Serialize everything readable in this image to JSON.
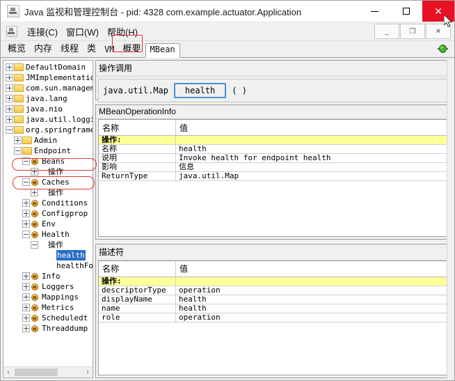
{
  "window": {
    "title": "Java 监视和管理控制台 - pid: 4328 com.example.actuator.Application",
    "app_icon": "java-console-icon",
    "minimize_label": "",
    "maximize_label": "",
    "close_label": "✕"
  },
  "menubar": {
    "icon": "java-console-icon",
    "items": [
      {
        "label": "连接(C)"
      },
      {
        "label": "窗口(W)"
      },
      {
        "label": "帮助(H)"
      }
    ],
    "internal_buttons": [
      {
        "name": "internal-minimize",
        "label": "_"
      },
      {
        "name": "internal-restore",
        "label": "❐"
      },
      {
        "name": "internal-close",
        "label": "✕"
      }
    ]
  },
  "tabs": {
    "items": [
      {
        "label": "概览",
        "selected": false
      },
      {
        "label": "内存",
        "selected": false
      },
      {
        "label": "线程",
        "selected": false
      },
      {
        "label": "类",
        "selected": false
      },
      {
        "label": "VM",
        "selected": false
      },
      {
        "label": "概要",
        "selected": false
      },
      {
        "label": "MBean",
        "selected": true
      }
    ],
    "status_icon": "green-plug-connected-icon"
  },
  "tree": {
    "nodes": [
      {
        "label": "DefaultDomain",
        "indent": 0,
        "handle": "plus",
        "icon": "folder"
      },
      {
        "label": "JMImplementatio",
        "indent": 0,
        "handle": "plus",
        "icon": "folder"
      },
      {
        "label": "com.sun.managem",
        "indent": 0,
        "handle": "plus",
        "icon": "folder"
      },
      {
        "label": "java.lang",
        "indent": 0,
        "handle": "plus",
        "icon": "folder"
      },
      {
        "label": "java.nio",
        "indent": 0,
        "handle": "plus",
        "icon": "folder"
      },
      {
        "label": "java.util.loggi",
        "indent": 0,
        "handle": "plus",
        "icon": "folder"
      },
      {
        "label": "org.springframe",
        "indent": 0,
        "handle": "minus",
        "icon": "folder"
      },
      {
        "label": "Admin",
        "indent": 1,
        "handle": "plus",
        "icon": "folder"
      },
      {
        "label": "Endpoint",
        "indent": 1,
        "handle": "minus",
        "icon": "folder"
      },
      {
        "label": "Beans",
        "indent": 2,
        "handle": "minus",
        "icon": "bean"
      },
      {
        "label": "操作",
        "indent": 3,
        "handle": "plus",
        "icon": "none"
      },
      {
        "label": "Caches",
        "indent": 2,
        "handle": "minus",
        "icon": "bean"
      },
      {
        "label": "操作",
        "indent": 3,
        "handle": "plus",
        "icon": "none"
      },
      {
        "label": "Conditions",
        "indent": 2,
        "handle": "plus",
        "icon": "bean"
      },
      {
        "label": "Configprop",
        "indent": 2,
        "handle": "plus",
        "icon": "bean"
      },
      {
        "label": "Env",
        "indent": 2,
        "handle": "plus",
        "icon": "bean"
      },
      {
        "label": "Health",
        "indent": 2,
        "handle": "minus",
        "icon": "bean"
      },
      {
        "label": "操作",
        "indent": 3,
        "handle": "minus",
        "icon": "none"
      },
      {
        "label": "health",
        "indent": 4,
        "handle": "none",
        "icon": "none",
        "selected": true
      },
      {
        "label": "healthFo",
        "indent": 4,
        "handle": "none",
        "icon": "none"
      },
      {
        "label": "Info",
        "indent": 2,
        "handle": "plus",
        "icon": "bean"
      },
      {
        "label": "Loggers",
        "indent": 2,
        "handle": "plus",
        "icon": "bean"
      },
      {
        "label": "Mappings",
        "indent": 2,
        "handle": "plus",
        "icon": "bean"
      },
      {
        "label": "Metrics",
        "indent": 2,
        "handle": "plus",
        "icon": "bean"
      },
      {
        "label": "Scheduledt",
        "indent": 2,
        "handle": "plus",
        "icon": "bean"
      },
      {
        "label": "Threaddump",
        "indent": 2,
        "handle": "plus",
        "icon": "bean"
      }
    ],
    "scrollbar": {
      "left_arrow": "‹",
      "right_arrow": "›"
    }
  },
  "invoke": {
    "section_title": "操作调用",
    "return_type": "java.util.Map",
    "operation_button": "health",
    "args": "( )"
  },
  "opinfo": {
    "section_title": "MBeanOperationInfo",
    "columns": [
      "名称",
      "值"
    ],
    "rows": [
      {
        "name": "操作:",
        "value": "",
        "highlight": true
      },
      {
        "name": "名称",
        "value": "health"
      },
      {
        "name": "说明",
        "value": "Invoke health for endpoint health"
      },
      {
        "name": "影响",
        "value": "信息"
      },
      {
        "name": "ReturnType",
        "value": "java.util.Map"
      }
    ]
  },
  "descriptor": {
    "section_title": "描述符",
    "columns": [
      "名称",
      "值"
    ],
    "rows": [
      {
        "name": "操作:",
        "value": "",
        "highlight": true
      },
      {
        "name": "descriptorType",
        "value": "operation"
      },
      {
        "name": "displayName",
        "value": "health"
      },
      {
        "name": "name",
        "value": "health"
      },
      {
        "name": "role",
        "value": "operation"
      }
    ]
  },
  "annotations": {
    "color": "#e03a32",
    "marks": [
      "org.springframe-ellipse",
      "Endpoint-ellipse",
      "MBean-tab-box"
    ]
  }
}
